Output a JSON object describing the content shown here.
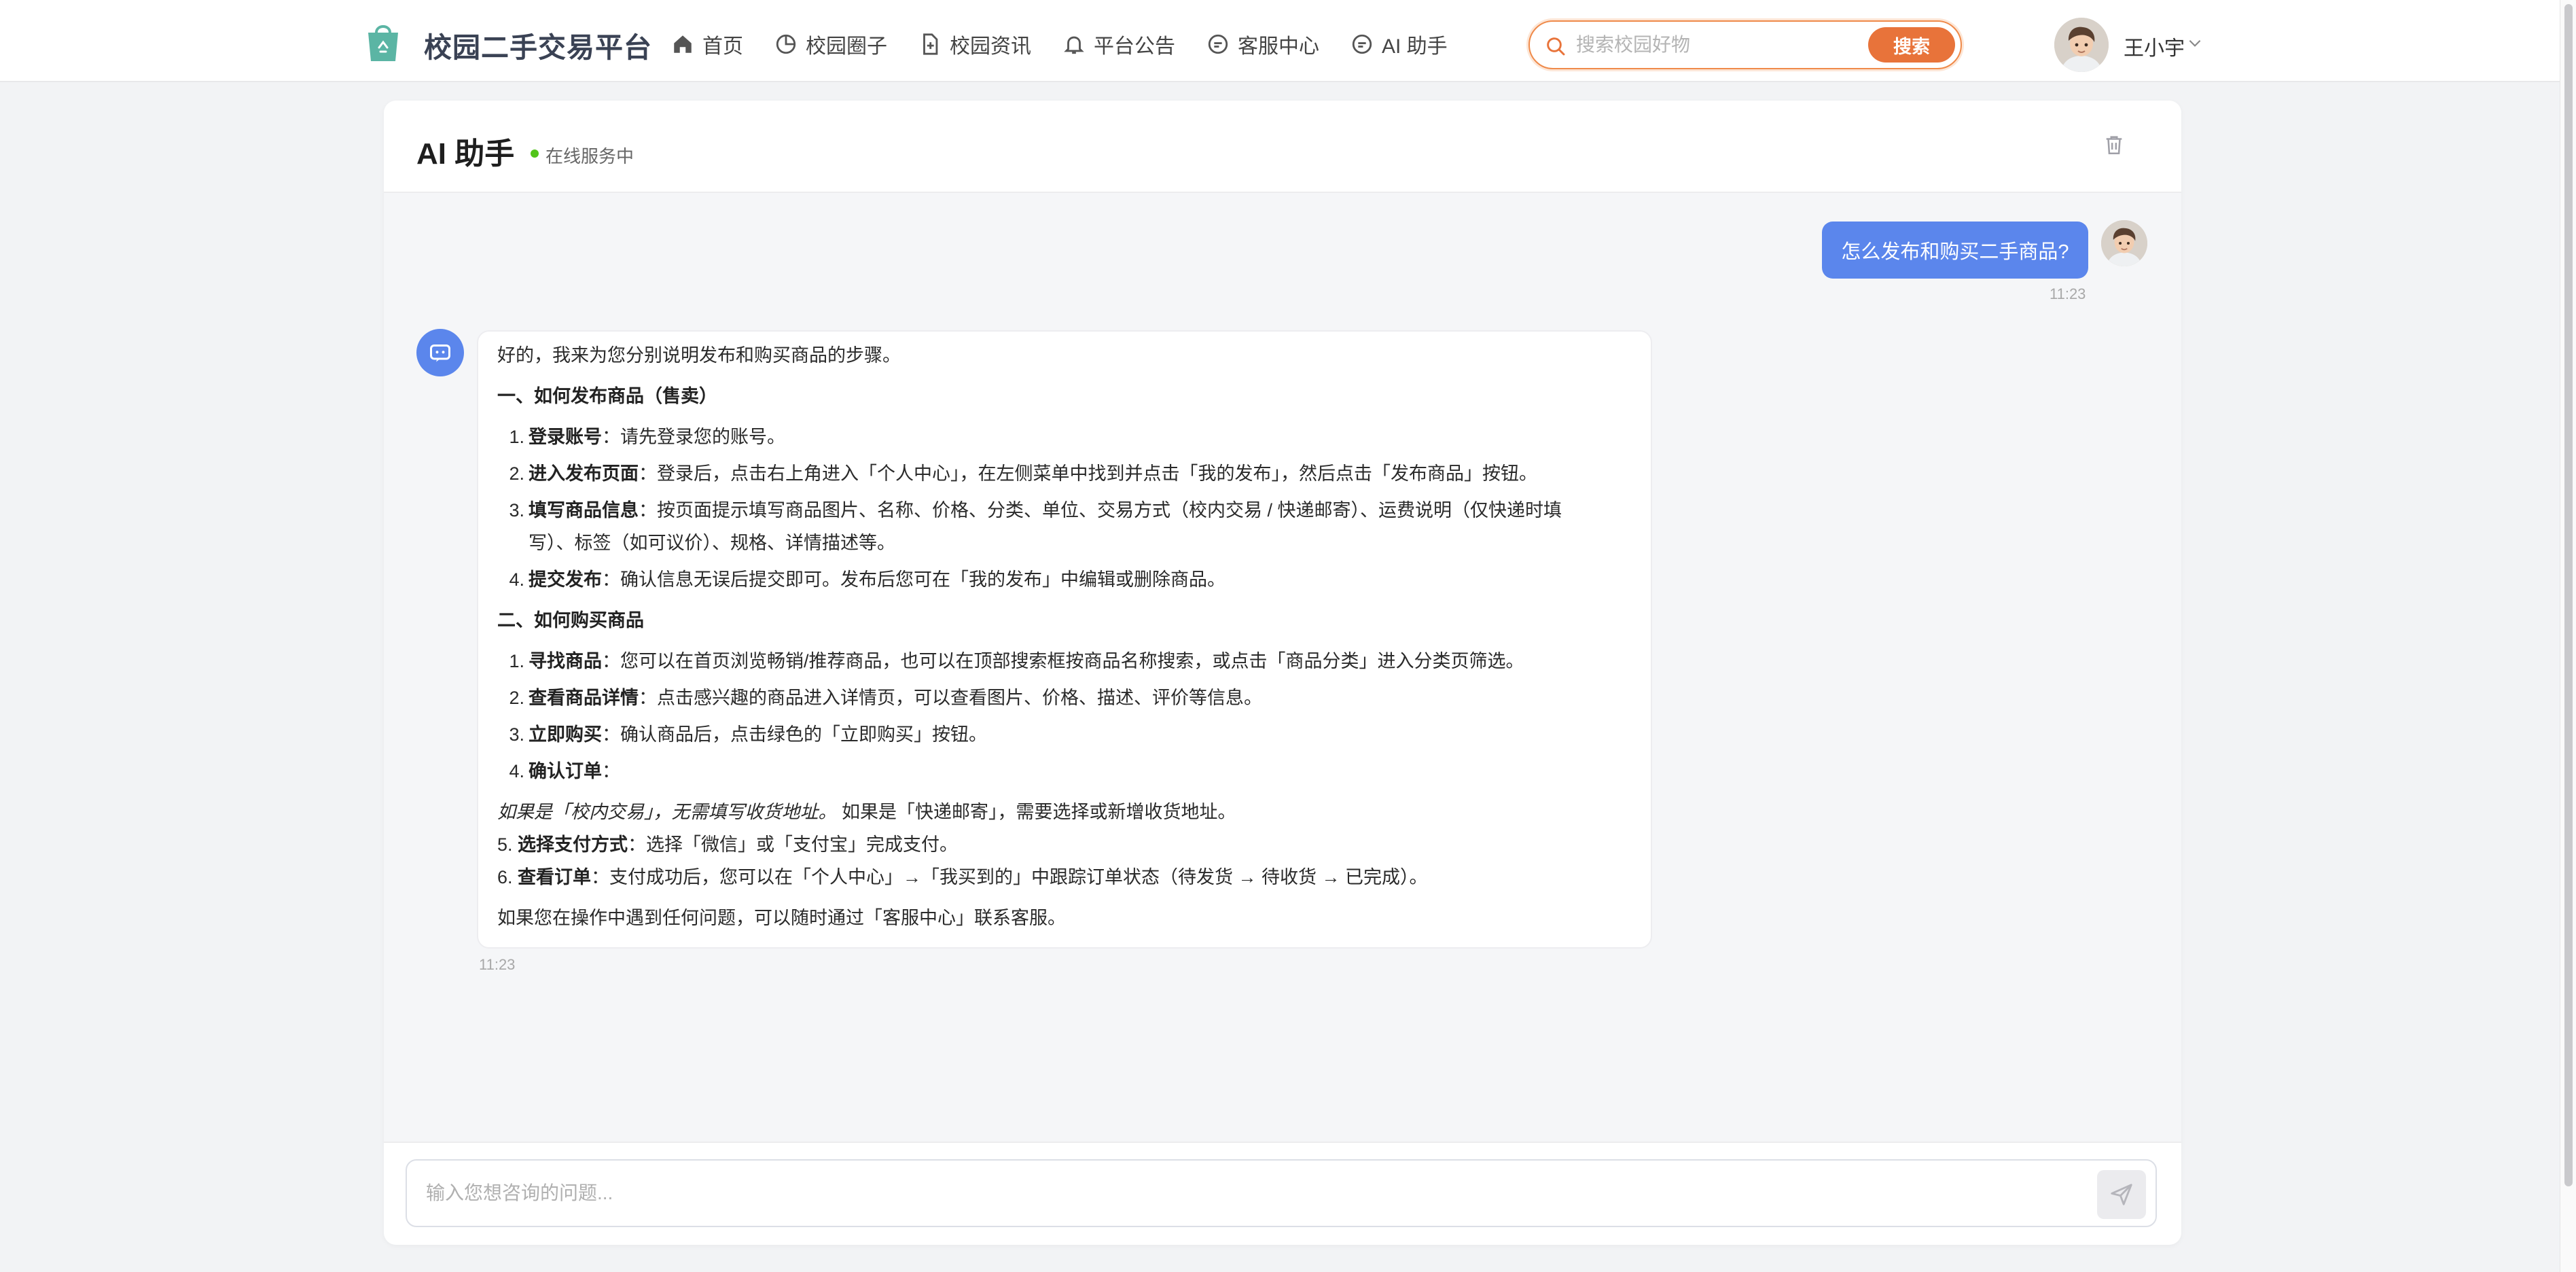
{
  "header": {
    "brand": "校园二手交易平台",
    "nav": [
      {
        "label": "首页",
        "icon": "home-icon"
      },
      {
        "label": "校园圈子",
        "icon": "pie-chart-icon"
      },
      {
        "label": "校园资讯",
        "icon": "document-plus-icon"
      },
      {
        "label": "平台公告",
        "icon": "bell-icon"
      },
      {
        "label": "客服中心",
        "icon": "chat-bubble-icon"
      },
      {
        "label": "AI 助手",
        "icon": "chat-bubble-icon"
      }
    ],
    "search": {
      "placeholder": "搜索校园好物",
      "button": "搜索"
    },
    "user": {
      "name": "王小宇"
    }
  },
  "chat": {
    "title": "AI 助手",
    "status": "在线服务中",
    "user_message": {
      "text": "怎么发布和购买二手商品?",
      "time": "11:23"
    },
    "bot_message": {
      "time": "11:23",
      "intro": "好的，我来为您分别说明发布和购买商品的步骤。",
      "section1_title": "一、如何发布商品（售卖）",
      "s1": [
        {
          "n": "1.",
          "b": "登录账号",
          "t": "：请先登录您的账号。"
        },
        {
          "n": "2.",
          "b": "进入发布页面",
          "t": "：登录后，点击右上角进入「个人中心」，在左侧菜单中找到并点击「我的发布」，然后点击「发布商品」按钮。"
        },
        {
          "n": "3.",
          "b": "填写商品信息",
          "t": "：按页面提示填写商品图片、名称、价格、分类、单位、交易方式（校内交易 / 快递邮寄）、运费说明（仅快递时填",
          "t2": "写）、标签（如可议价）、规格、详情描述等。"
        },
        {
          "n": "4.",
          "b": "提交发布",
          "t": "：确认信息无误后提交即可。发布后您可在「我的发布」中编辑或删除商品。"
        }
      ],
      "section2_title": "二、如何购买商品",
      "s2": [
        {
          "n": "1.",
          "b": "寻找商品",
          "t": "：您可以在首页浏览畅销/推荐商品，也可以在顶部搜索框按商品名称搜索，或点击「商品分类」进入分类页筛选。"
        },
        {
          "n": "2.",
          "b": "查看商品详情",
          "t": "：点击感兴趣的商品进入详情页，可以查看图片、价格、描述、评价等信息。"
        },
        {
          "n": "3.",
          "b": "立即购买",
          "t": "：确认商品后，点击绿色的「立即购买」按钮。"
        },
        {
          "n": "4.",
          "b": "确认订单",
          "t": "："
        }
      ],
      "note_italic": "如果是「校内交易」，无需填写收货地址。",
      "note_rest": " 如果是「快递邮寄」，需要选择或新增收货地址。",
      "s3": [
        {
          "n": "5.",
          "b": "选择支付方式",
          "t": "：选择「微信」或「支付宝」完成支付。"
        },
        {
          "n": "6.",
          "b": "查看订单",
          "t": "：支付成功后，您可以在「个人中心」→「我买到的」中跟踪订单状态（待发货 → 待收货 → 已完成）。"
        }
      ],
      "outro": "如果您在操作中遇到任何问题，可以随时通过「客服中心」联系客服。"
    },
    "input_placeholder": "输入您想咨询的问题..."
  },
  "colors": {
    "accent": "#5b86ec",
    "search_accent": "#e8733a",
    "brand_text": "#3a4254",
    "logo": "#5bb5a4"
  }
}
